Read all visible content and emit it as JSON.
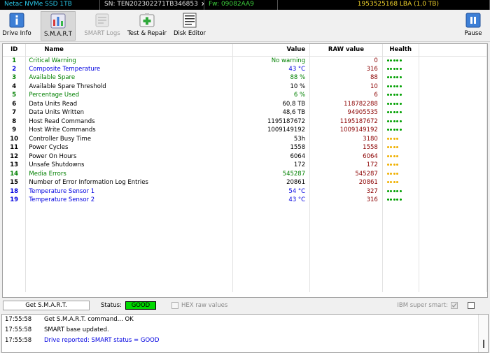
{
  "infobar": {
    "model": "Netac NVMe SSD 1TB",
    "sn": "SN: TEN202302271TB346853",
    "sn_close": "x",
    "fw": "Fw: 09082AA9",
    "lba": "1953525168 LBA (1,0 TB)"
  },
  "toolbar": {
    "drive_info": "Drive Info",
    "smart": "S.M.A.R.T",
    "smart_logs": "SMART Logs",
    "test_repair": "Test & Repair",
    "disk_editor": "Disk Editor",
    "pause": "Pause"
  },
  "table": {
    "headers": {
      "id": "ID",
      "name": "Name",
      "value": "Value",
      "raw": "RAW value",
      "health": "Health"
    },
    "rows": [
      {
        "id": "1",
        "name": "Critical Warning",
        "value": "No warning",
        "raw": "0",
        "color": "green",
        "health": "good"
      },
      {
        "id": "2",
        "name": "Composite Temperature",
        "value": "43 °C",
        "raw": "316",
        "color": "blue",
        "health": "good"
      },
      {
        "id": "3",
        "name": "Available Spare",
        "value": "88 %",
        "raw": "88",
        "color": "green",
        "health": "good"
      },
      {
        "id": "4",
        "name": "Available Spare Threshold",
        "value": "10 %",
        "raw": "10",
        "color": "black",
        "health": "good"
      },
      {
        "id": "5",
        "name": "Percentage Used",
        "value": "6 %",
        "raw": "6",
        "color": "green",
        "health": "good"
      },
      {
        "id": "6",
        "name": "Data Units Read",
        "value": "60,8 TB",
        "raw": "118782288",
        "color": "black",
        "health": "good"
      },
      {
        "id": "7",
        "name": "Data Units Written",
        "value": "48,6 TB",
        "raw": "94905535",
        "color": "black",
        "health": "good"
      },
      {
        "id": "8",
        "name": "Host Read Commands",
        "value": "1195187672",
        "raw": "1195187672",
        "color": "black",
        "health": "good"
      },
      {
        "id": "9",
        "name": "Host Write Commands",
        "value": "1009149192",
        "raw": "1009149192",
        "color": "black",
        "health": "good"
      },
      {
        "id": "10",
        "name": "Controller Busy Time",
        "value": "53h",
        "raw": "3180",
        "color": "black",
        "health": "info"
      },
      {
        "id": "11",
        "name": "Power Cycles",
        "value": "1558",
        "raw": "1558",
        "color": "black",
        "health": "info"
      },
      {
        "id": "12",
        "name": "Power On Hours",
        "value": "6064",
        "raw": "6064",
        "color": "black",
        "health": "info"
      },
      {
        "id": "13",
        "name": "Unsafe Shutdowns",
        "value": "172",
        "raw": "172",
        "color": "black",
        "health": "info"
      },
      {
        "id": "14",
        "name": "Media Errors",
        "value": "545287",
        "raw": "545287",
        "color": "green",
        "health": "info"
      },
      {
        "id": "15",
        "name": "Number of Error Information Log Entries",
        "value": "20861",
        "raw": "20861",
        "color": "black",
        "health": "info"
      },
      {
        "id": "18",
        "name": "Temperature Sensor 1",
        "value": "54 °C",
        "raw": "327",
        "color": "blue",
        "health": "good"
      },
      {
        "id": "19",
        "name": "Temperature Sensor 2",
        "value": "43 °C",
        "raw": "316",
        "color": "blue",
        "health": "good"
      }
    ]
  },
  "colors": {
    "green": "#008000",
    "blue": "#0000e0",
    "black": "#000000",
    "raw": "#8b0000",
    "health_good": "#00a000",
    "health_info": "#f0b000",
    "status_good": "#00d900"
  },
  "statusbar": {
    "get_smart": "Get S.M.A.R.T.",
    "status_label": "Status:",
    "status_value": "GOOD",
    "hex_label": "HEX raw values",
    "ibm_label": "IBM super smart:"
  },
  "log": [
    {
      "time": "17:55:58",
      "msg": "Get S.M.A.R.T. command... OK",
      "color": "#000000"
    },
    {
      "time": "17:55:58",
      "msg": "SMART base updated.",
      "color": "#000000"
    },
    {
      "time": "17:55:58",
      "msg": "Drive reported: SMART status = GOOD",
      "color": "#0000e0"
    }
  ]
}
